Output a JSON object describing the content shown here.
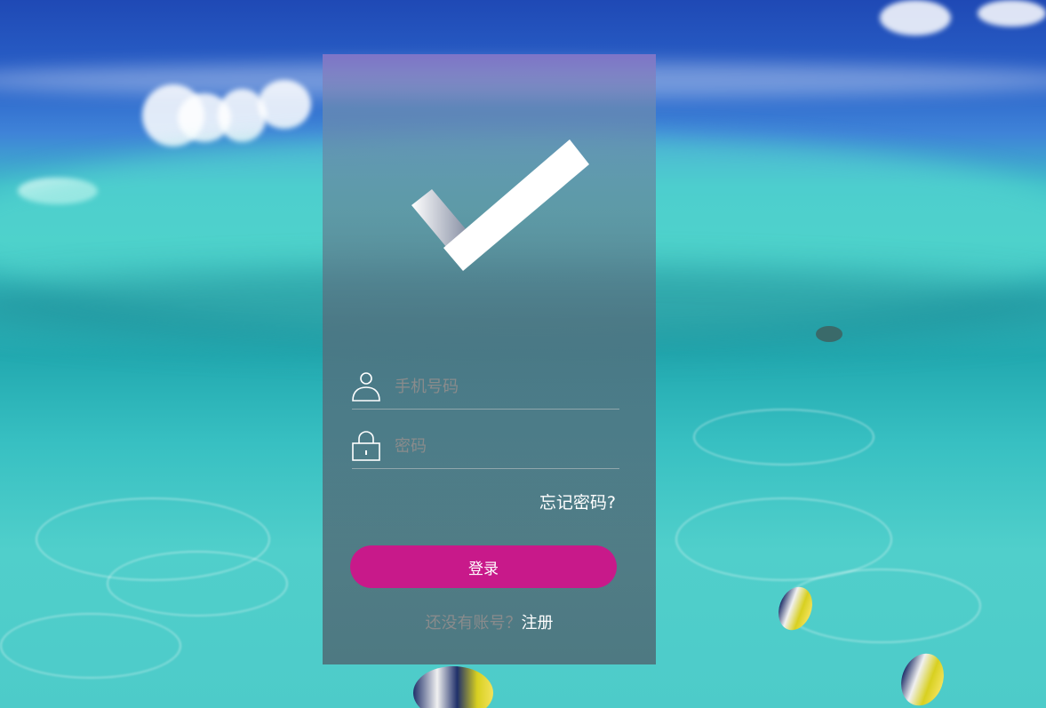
{
  "colors": {
    "accent": "#c8198a",
    "panel_tint": "#5a7480",
    "text_light": "#ffffff",
    "placeholder": "#8c8c8c"
  },
  "logo": {
    "icon": "checkmark-logo-icon"
  },
  "form": {
    "phone": {
      "icon": "user-icon",
      "placeholder": "手机号码",
      "value": ""
    },
    "password": {
      "icon": "lock-icon",
      "placeholder": "密码",
      "value": ""
    },
    "forgot_label": "忘记密码?",
    "login_label": "登录",
    "register_prompt": "还没有账号？",
    "register_label": "注册"
  }
}
